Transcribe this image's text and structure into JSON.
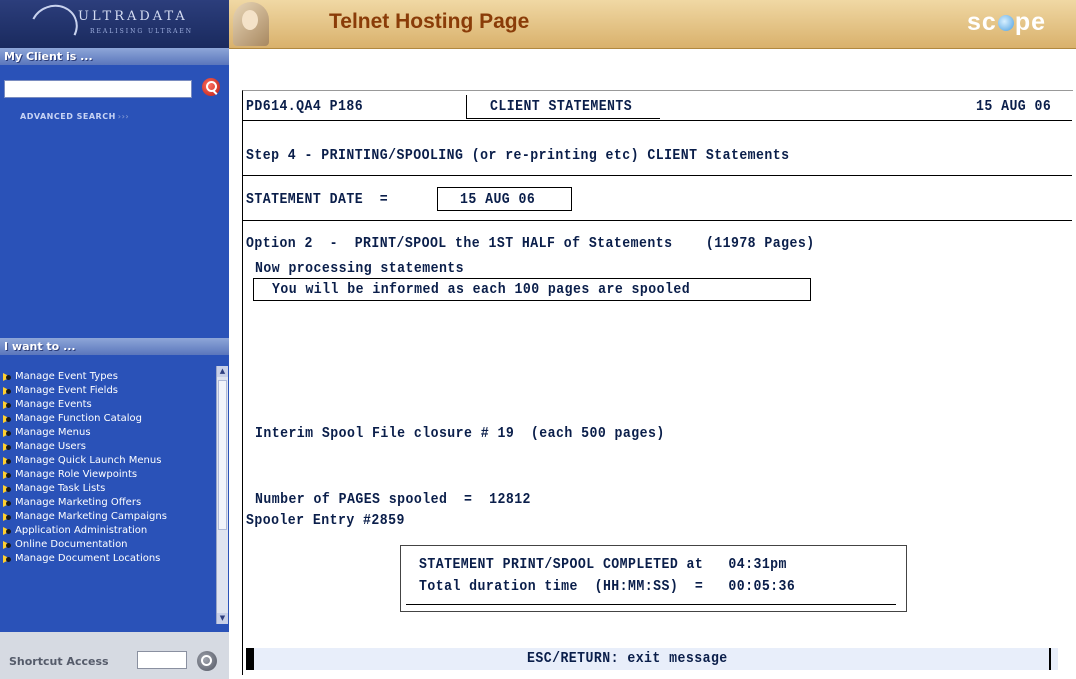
{
  "sidebar": {
    "logo": {
      "text": "ULTRADATA",
      "tagline": "REALISING ULTRAEN"
    },
    "client_section": {
      "title": "My Client is ...",
      "advanced_search": "ADVANCED SEARCH"
    },
    "i_want_to": {
      "title": "I want to ...",
      "items": [
        "Manage Event Types",
        "Manage Event Fields",
        "Manage Events",
        "Manage Function Catalog",
        "Manage Menus",
        "Manage Users",
        "Manage Quick Launch Menus",
        "Manage Role Viewpoints",
        "Manage Task Lists",
        "Manage Marketing Offers",
        "Manage Marketing Campaigns",
        "Application Administration",
        "Online Documentation",
        "Manage Document Locations"
      ]
    },
    "shortcut": {
      "label": "Shortcut Access"
    }
  },
  "header": {
    "title": "Telnet Hosting Page",
    "brand": {
      "pre": "sc",
      "post": "pe"
    }
  },
  "terminal": {
    "program_id": "PD614.QA4 P186",
    "screen_title": "CLIENT STATEMENTS",
    "date": "15 AUG 06",
    "step": "Step 4 - PRINTING/SPOOLING (or re-printing etc) CLIENT Statements",
    "statement_date_label": "STATEMENT DATE  =",
    "statement_date_value": "15 AUG 06",
    "option_line": "Option 2  -  PRINT/SPOOL the 1ST HALF of Statements    (11978 Pages)",
    "processing": "Now processing statements",
    "info_message": "You will be informed as each 100 pages are spooled",
    "interim": "Interim Spool File closure # 19  (each 500 pages)",
    "pages_spooled": "Number of PAGES spooled  =  12812",
    "spooler_entry": "Spooler Entry #2859",
    "completed_line": "STATEMENT PRINT/SPOOL COMPLETED at   04:31pm",
    "duration_line": "Total duration time  (HH:MM:SS)  =   00:05:36",
    "status_message": "ESC/RETURN: exit message"
  }
}
